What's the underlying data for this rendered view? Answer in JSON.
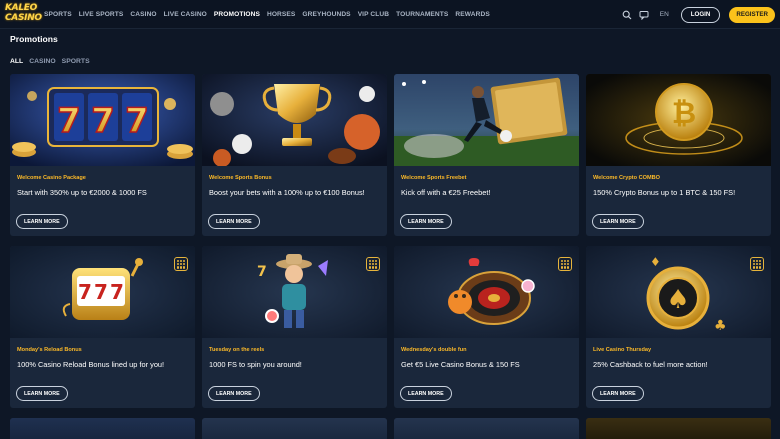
{
  "logo": {
    "line1": "KALEO",
    "line2": "CASINO"
  },
  "nav": [
    "SPORTS",
    "LIVE SPORTS",
    "CASINO",
    "LIVE CASINO",
    "PROMOTIONS",
    "HORSES",
    "GREYHOUNDS",
    "VIP CLUB",
    "TOURNAMENTS",
    "REWARDS"
  ],
  "nav_active": "PROMOTIONS",
  "header": {
    "lang": "EN",
    "login": "LOGIN",
    "register": "REGISTER"
  },
  "icons": {
    "search": "search-icon",
    "chat": "chat-icon",
    "badge": "gift-badge-icon"
  },
  "page": {
    "title": "Promotions"
  },
  "filters": [
    "ALL",
    "CASINO",
    "SPORTS"
  ],
  "colors": {
    "accent": "#fbc21b",
    "category": "#fbb928",
    "card_bg": "#1a273b",
    "page_bg": "#0e1726"
  },
  "cards": [
    {
      "category": "Welcome Casino Package",
      "title": "Start with 350% up to €2000 & 1000 FS",
      "cta": "LEARN MORE"
    },
    {
      "category": "Welcome Sports Bonus",
      "title": "Boost your bets with a 100% up to €100 Bonus!",
      "cta": "LEARN MORE"
    },
    {
      "category": "Welcome Sports Freebet",
      "title": "Kick off with a €25 Freebet!",
      "cta": "LEARN MORE"
    },
    {
      "category": "Welcome Crypto COMBO",
      "title": "150% Crypto Bonus up to 1 BTC & 150 FS!",
      "cta": "LEARN MORE"
    },
    {
      "category": "Monday's Reload Bonus",
      "title": "100% Casino Reload Bonus lined up for you!",
      "cta": "LEARN MORE"
    },
    {
      "category": "Tuesday on the reels",
      "title": "1000 FS to spin you around!",
      "cta": "LEARN MORE"
    },
    {
      "category": "Wednesday's double fun",
      "title": "Get €5 Live Casino Bonus & 150 FS",
      "cta": "LEARN MORE"
    },
    {
      "category": "Live Casino Thursday",
      "title": "25% Cashback to fuel more action!",
      "cta": "LEARN MORE"
    }
  ],
  "art": {
    "reel_symbols": [
      "7",
      "7",
      "7"
    ],
    "coin_symbol": "₿",
    "suit_symbol": "♠"
  }
}
